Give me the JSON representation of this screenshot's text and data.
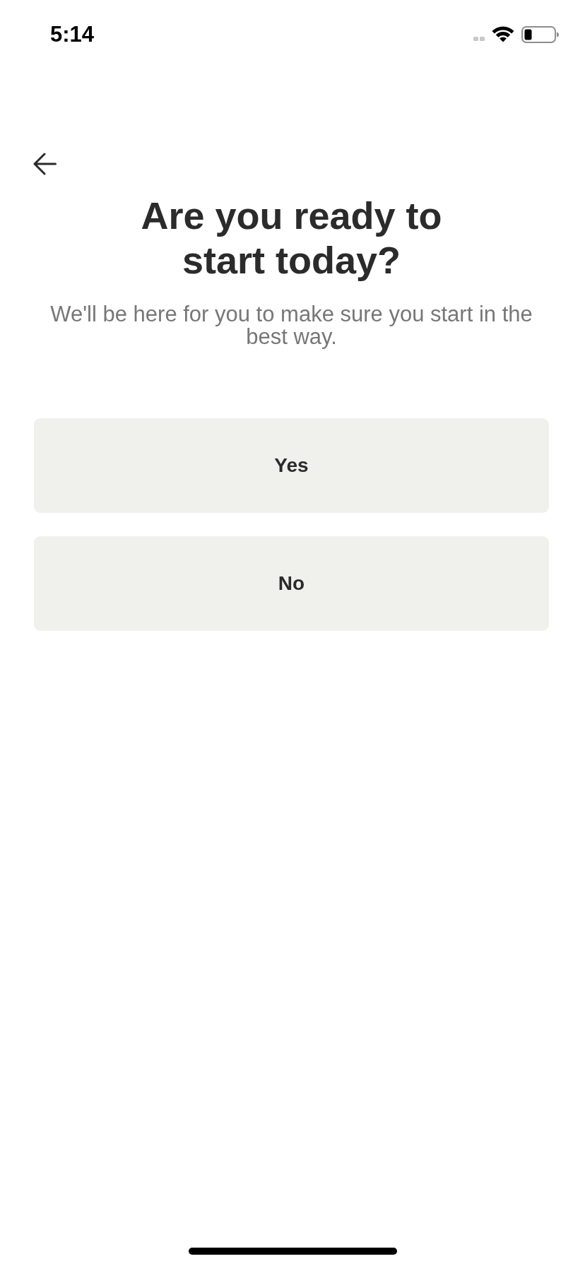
{
  "status_bar": {
    "time": "5:14"
  },
  "header": {
    "title": "Are you ready to start today?",
    "subtitle": "We'll be here for you to make sure you start in the best way."
  },
  "answers": [
    {
      "label": "Yes"
    },
    {
      "label": "No"
    }
  ]
}
